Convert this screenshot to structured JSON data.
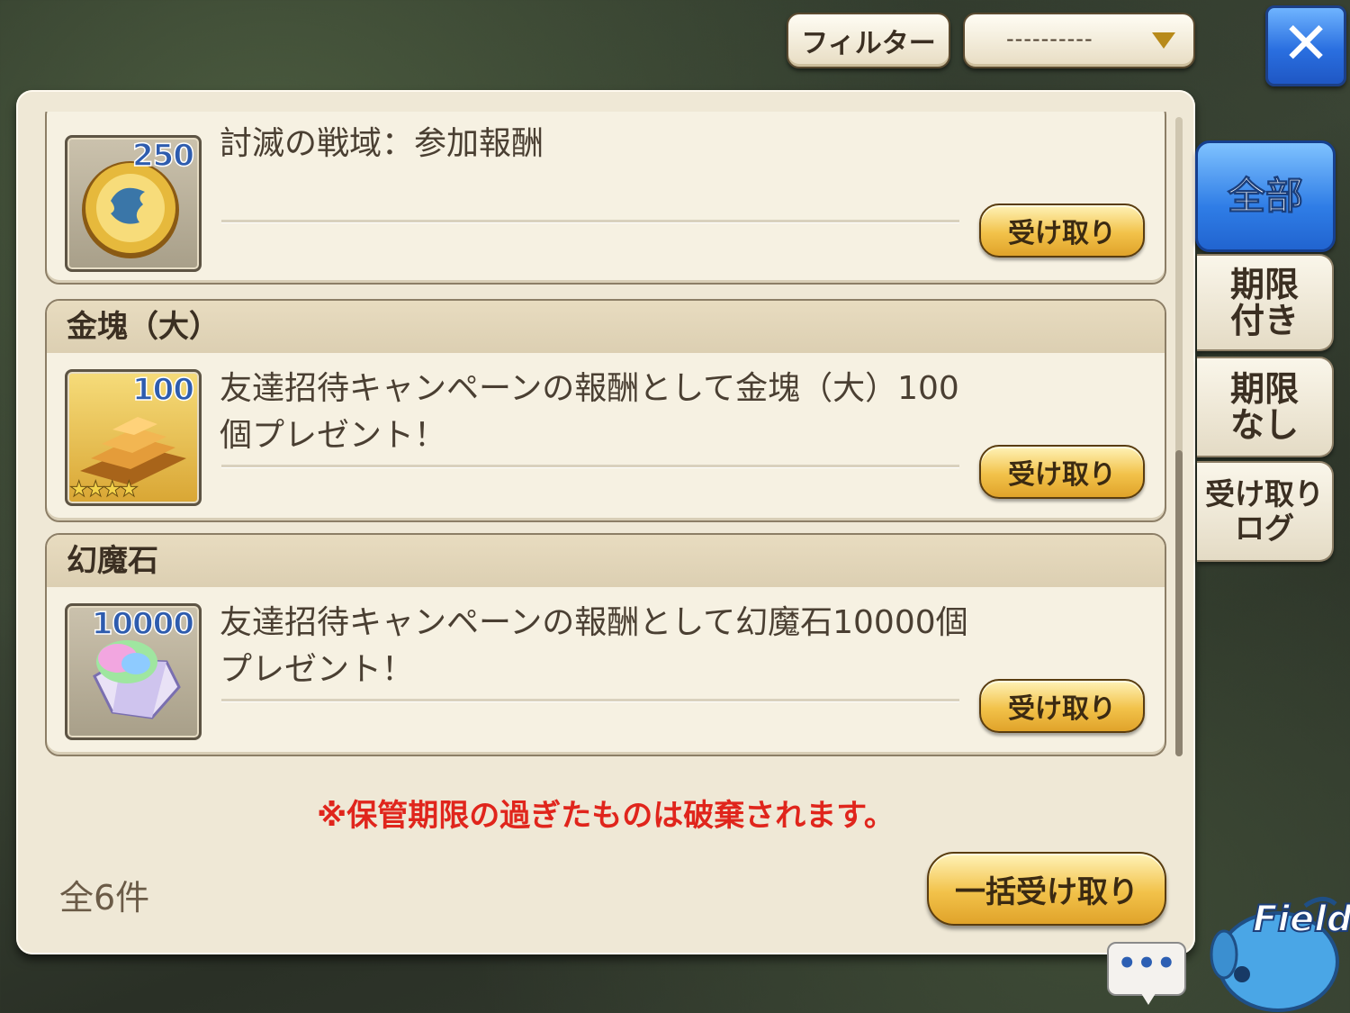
{
  "top_bar": {
    "filter_label": "フィルター",
    "filter_select_value": "----------"
  },
  "tabs": [
    {
      "label": "全部",
      "active": true
    },
    {
      "label": "期限\n付き",
      "active": false
    },
    {
      "label": "期限\nなし",
      "active": false
    },
    {
      "label": "受け取り\nログ",
      "active": false
    }
  ],
  "items": [
    {
      "header": "",
      "qty": "250",
      "description": "討滅の戦域：参加報酬",
      "claim_label": "受け取り",
      "icon": "coin-icon"
    },
    {
      "header": "金塊（大）",
      "qty": "100",
      "stars": "★★★★",
      "description": "友達招待キャンペーンの報酬として金塊（大）100個プレゼント！",
      "claim_label": "受け取り",
      "icon": "gold-bars-icon"
    },
    {
      "header": "幻魔石",
      "qty": "10000",
      "description": "友達招待キャンペーンの報酬として幻魔石10000個プレゼント！",
      "claim_label": "受け取り",
      "icon": "magicite-icon"
    }
  ],
  "notice": "※保管期限の過ぎたものは破棄されます。",
  "total_count": "全6件",
  "bulk_claim_label": "一括受け取り",
  "chat_indicator": "•••",
  "field_label": "Field",
  "colors": {
    "notice": "#e0251c",
    "active_tab": "#2f7de6",
    "claim_button": "#f2c24a"
  }
}
